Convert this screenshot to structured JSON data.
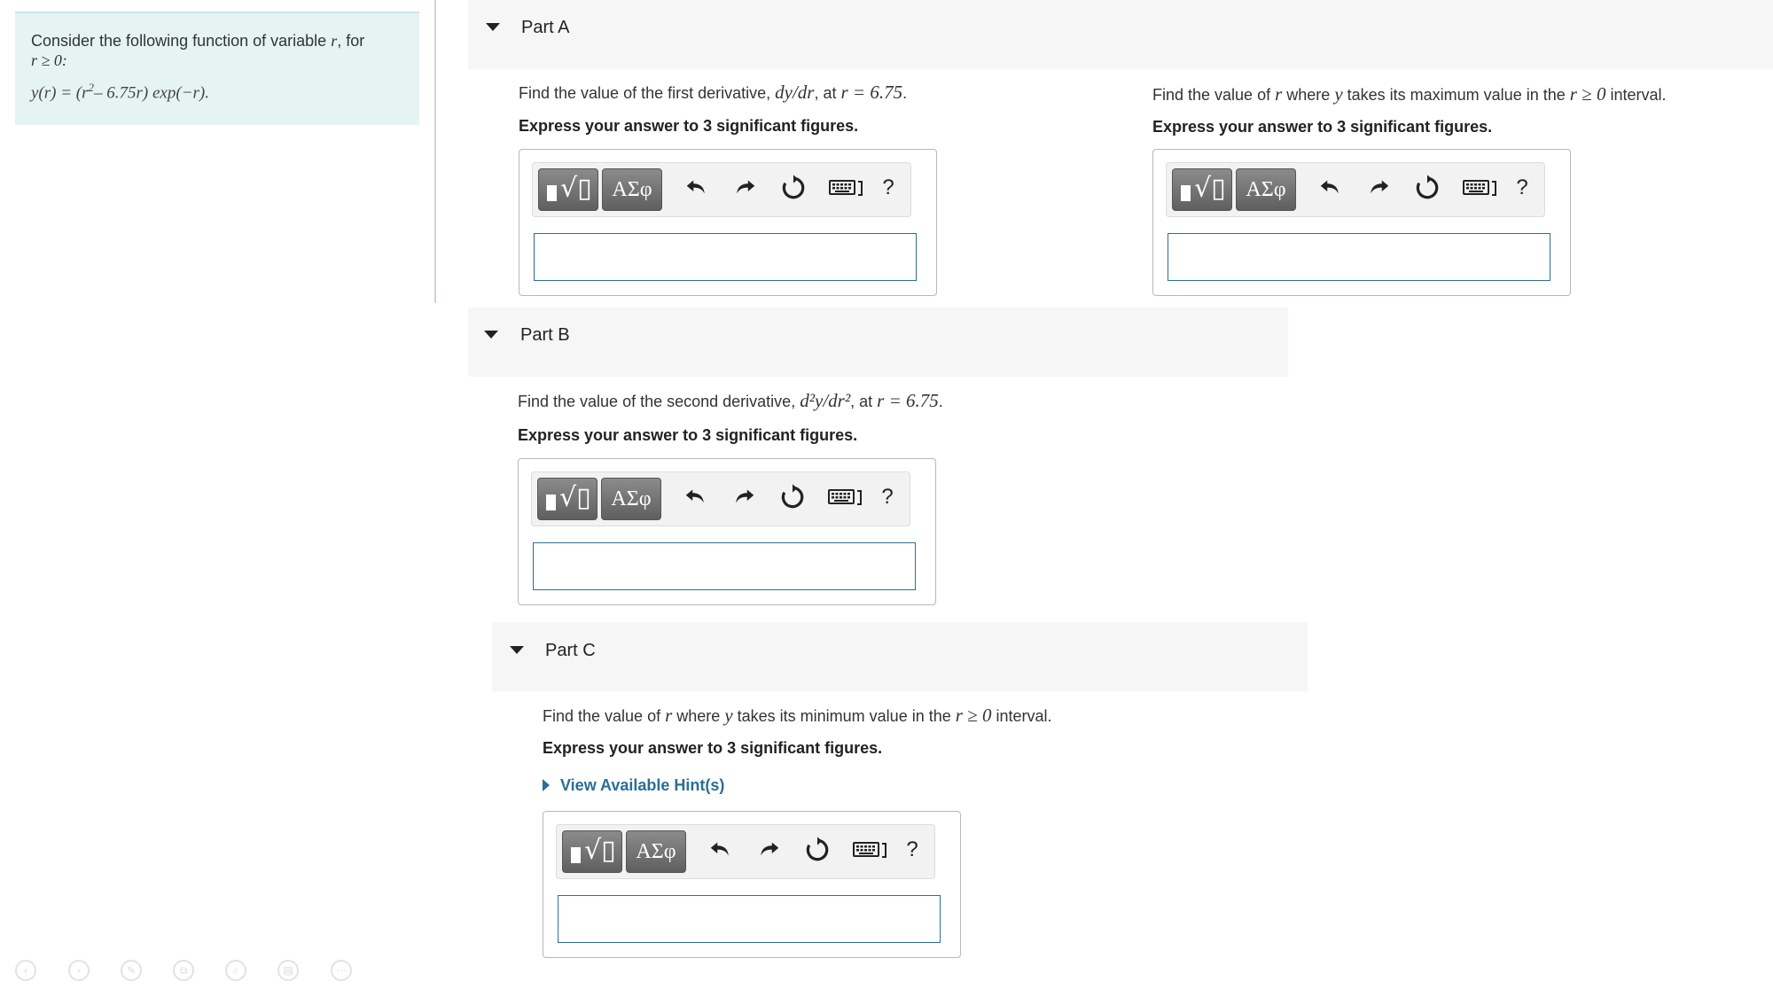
{
  "intro": {
    "line1_prefix": "Consider the following function of variable ",
    "var": "r",
    "line1_suffix": ", for",
    "condition": "r ≥ 0:",
    "formula_lhs": "y(r) = (r",
    "formula_exp": "2",
    "formula_mid": "– 6.75r) exp(−r)."
  },
  "partA": {
    "label": "Part A",
    "question_prefix": "Find the value of the first derivative, ",
    "question_math": "dy/dr",
    "question_mid": ", at ",
    "question_math2": "r = 6.75",
    "question_suffix": ".",
    "instruction": "Express your answer to 3 significant figures."
  },
  "partA2": {
    "question_prefix": "Find the value of ",
    "var_r": "r",
    "question_mid": " where ",
    "var_y": "y",
    "question_mid2": " takes its maximum value in the ",
    "cond": "r ≥ 0",
    "question_suffix": " interval.",
    "instruction": "Express your answer to 3 significant figures."
  },
  "partB": {
    "label": "Part B",
    "question_prefix": "Find the value of the second derivative, ",
    "question_math": "d²y/dr²",
    "question_mid": ", at ",
    "question_math2": "r = 6.75",
    "question_suffix": ".",
    "instruction": "Express your answer to 3 significant figures."
  },
  "partC": {
    "label": "Part C",
    "question_prefix": "Find the value of ",
    "var_r": "r",
    "question_mid": " where ",
    "var_y": "y",
    "question_mid2": " takes its minimum value in the ",
    "cond": "r ≥ 0",
    "question_suffix": " interval.",
    "instruction": "Express your answer to 3 significant figures.",
    "hint": "View Available Hint(s)"
  },
  "widget": {
    "greek_label": "ΑΣφ",
    "help_label": "?",
    "answer_value": ""
  },
  "icons": {
    "template": "template-icon",
    "undo": "undo-icon",
    "redo": "redo-icon",
    "reset": "reset-icon",
    "keyboard": "keyboard-icon",
    "help": "help-icon"
  },
  "colors": {
    "intro_bg": "#e5f3f3",
    "input_border": "#2f6d97",
    "hint_link": "#2a6f96",
    "button_dark": "#6f6f6f"
  }
}
